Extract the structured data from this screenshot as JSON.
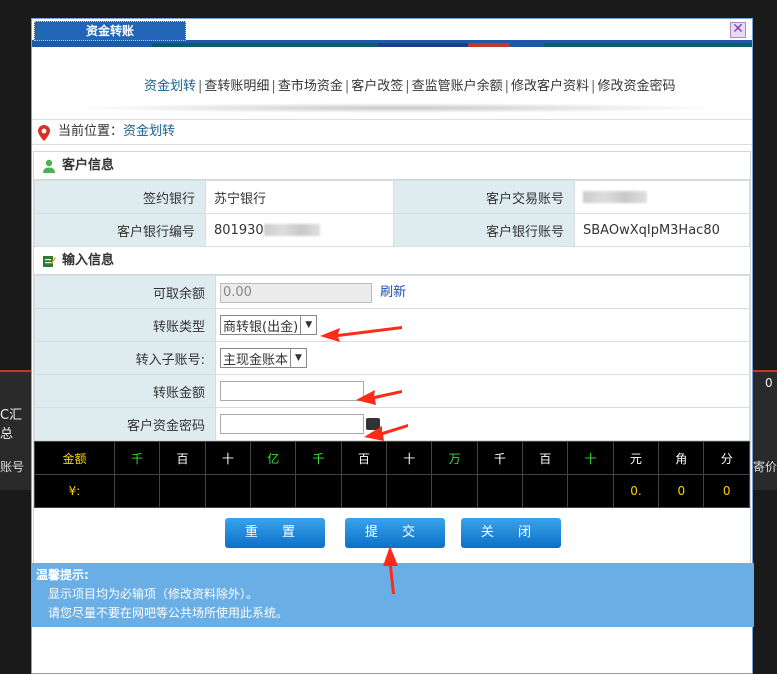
{
  "background": {
    "left_text_1": "C汇总",
    "left_text_2": "账号",
    "right_text_1": "0",
    "right_text_2": "寄价"
  },
  "dialog": {
    "title": "资金转账",
    "close_symbol": "✕"
  },
  "menu": [
    {
      "label": "资金划转",
      "active": true
    },
    {
      "label": "查转账明细",
      "active": false
    },
    {
      "label": "查市场资金",
      "active": false
    },
    {
      "label": "客户改签",
      "active": false
    },
    {
      "label": "查监管账户余额",
      "active": false
    },
    {
      "label": "修改客户资料",
      "active": false
    },
    {
      "label": "修改资金密码",
      "active": false
    }
  ],
  "location": {
    "prefix": "当前位置：",
    "current": "资金划转"
  },
  "customer_info": {
    "heading": "客户信息",
    "signing_bank_label": "签约银行",
    "signing_bank_value": "苏宁银行",
    "trade_account_label": "客户交易账号",
    "bank_code_label": "客户银行编号",
    "bank_code_value": "801930",
    "bank_account_label": "客户银行账号",
    "bank_account_value": "SBAOwXqIpM3Hac80"
  },
  "input_info": {
    "heading": "输入信息",
    "available_label": "可取余额",
    "available_value": "0.00",
    "refresh_label": "刷新",
    "transfer_type_label": "转账类型",
    "transfer_type_value": "商转银(出金)",
    "sub_account_label": "转入子账号:",
    "sub_account_value": "主现金账本",
    "amount_label": "转账金额",
    "password_label": "客户资金密码"
  },
  "amount_grid": {
    "header": [
      "金额",
      "千",
      "百",
      "十",
      "亿",
      "千",
      "百",
      "十",
      "万",
      "千",
      "百",
      "十",
      "元",
      "角",
      "分"
    ],
    "values": [
      "¥:",
      "",
      "",
      "",
      "",
      "",
      "",
      "",
      "",
      "",
      "",
      "",
      "0.",
      "0",
      "0"
    ]
  },
  "buttons": {
    "reset": "重 置",
    "submit": "提 交",
    "close": "关 闭"
  },
  "tips": {
    "title": "温馨提示:",
    "line1": "显示项目均为必输项（修改资料除外）。",
    "line2": "请您尽量不要在网吧等公共场所使用此系统。"
  },
  "colors": {
    "accent": "#1d5aa8",
    "label_bg": "#dfecef",
    "tips_bg": "#6aaee6",
    "link": "#17628f",
    "annotation_arrow": "#ff2a1a"
  }
}
